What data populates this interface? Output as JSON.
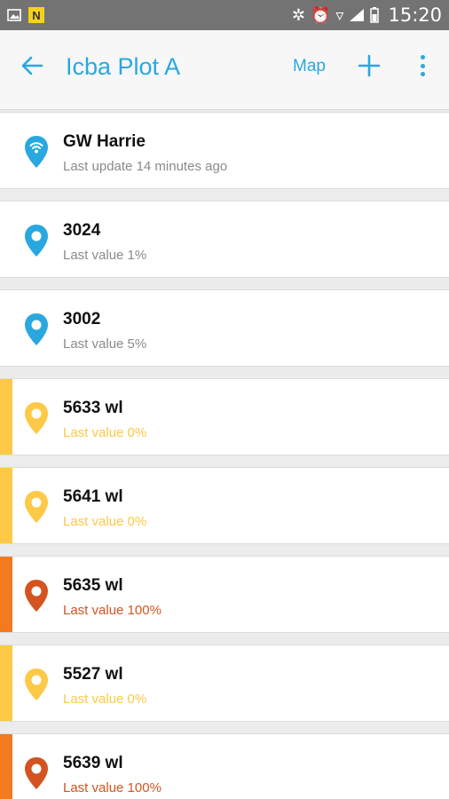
{
  "status_bar": {
    "time": "15:20"
  },
  "app_bar": {
    "title": "Icba Plot A",
    "map_label": "Map"
  },
  "colors": {
    "accent": "#29a8e0",
    "yellow": "#fdc946",
    "orange": "#f47a20",
    "red": "#d35420"
  },
  "items": [
    {
      "name": "GW Harrie",
      "sub": "Last update 14 minutes ago",
      "status": "gateway"
    },
    {
      "name": "3024",
      "sub": "Last value 1%",
      "status": "normal"
    },
    {
      "name": "3002",
      "sub": "Last value 5%",
      "status": "normal"
    },
    {
      "name": "5633 wl",
      "sub": "Last value 0%",
      "status": "warning"
    },
    {
      "name": "5641 wl",
      "sub": "Last value 0%",
      "status": "warning"
    },
    {
      "name": "5635 wl",
      "sub": "Last value 100%",
      "status": "alert"
    },
    {
      "name": "5527 wl",
      "sub": "Last value 0%",
      "status": "warning"
    },
    {
      "name": "5639 wl",
      "sub": "Last value 100%",
      "status": "alert"
    }
  ]
}
